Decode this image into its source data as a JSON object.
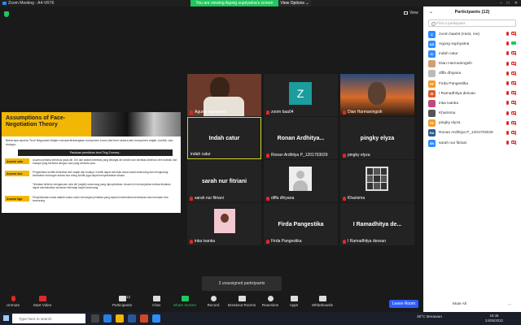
{
  "window": {
    "title": "Zoom Meeting - A4-VR76",
    "share_banner": "You are viewing Agung supriyatna's screen",
    "view_options": "View Options ⌄",
    "view_label": "View"
  },
  "slide": {
    "title": "Assumptions of Face-Negotiation Theory",
    "intro": "Beberapa asumsi Teori Negosiasi Wajah mempertimbangkan komponen kunci dari teori antara lain komponen wajah, konflik, dan budaya.",
    "bar": "Panduan pemikiran teori Ting-Toomey :",
    "rows": [
      {
        "label": "Asumsi satu",
        "text": "Asumsi pertama berfokus pada diri. Diri dan adalah identitas yang dihargai diri sendiri dan identitas dibentuk oleh individu dari budaya yang berbeda dengan cara yang berbeda pula."
      },
      {
        "label": "Asumsi dua",
        "text": "Pengelolaan konflik dimediasi oleh wajah dan budaya. Konflik dapat merusak muka sosial seseorang dan mengurangi kedekatan hubungan antara dua orang konflik juga dapat menyelesaikan situasi."
      },
      {
        "label": "",
        "text": "Tindakan tertentu mengancam citra diri (wajah) seseorang yang diproyeksikan. Asumsi ini menunjukkan bahwa tindakan dapat menimbulkan ancaman terhadap wajah seseorang."
      },
      {
        "label": "Asumsi tiga",
        "text": "Penyelamatan muka adalah usaha untuk mencegah peristiwa yang dapat menimbulkan kerentanan dan merusak citra seseorang."
      }
    ]
  },
  "tiles": [
    {
      "name": "Agung supriyatna",
      "big": ""
    },
    {
      "name": "zoom baa04",
      "big": "",
      "avatar": "Z"
    },
    {
      "name": "Dian Harmaningsih",
      "big": ""
    },
    {
      "name": "indah catur",
      "big": "Indah catur"
    },
    {
      "name": "Ronan Ardhitya P_1201703029",
      "big": "Ronan  Ardhitya..."
    },
    {
      "name": "pingky elyza",
      "big": "pingky elyza"
    },
    {
      "name": "sarah nur fitriani",
      "big": "sarah nur fitriani"
    },
    {
      "name": "diffa dhiyana",
      "big": ""
    },
    {
      "name": "Kharisma",
      "big": ""
    },
    {
      "name": "inka ivanka",
      "big": ""
    },
    {
      "name": "Firda Pangestika",
      "big": "Firda Pangestika"
    },
    {
      "name": "I Ramadhitya desvan",
      "big": "I Ramadhitya de..."
    }
  ],
  "unassigned": "3 unassigned participants",
  "toolbar": {
    "unmute": "Unmute",
    "start_video": "Start Video",
    "participants": "Participants",
    "participants_count": "12",
    "chat": "Chat",
    "share_screen": "Share Screen",
    "record": "Record",
    "breakout": "Breakout Rooms",
    "reactions": "Reactions",
    "apps": "Apps",
    "whiteboards": "Whiteboards",
    "leave": "Leave Room"
  },
  "panel": {
    "title": "Participants (12)",
    "search_placeholder": "Find a participant",
    "participants": [
      {
        "initials": "Z",
        "name": "zoom baa04 (Host, me)",
        "color": "#2d8cff",
        "video": "off"
      },
      {
        "initials": "AS",
        "name": "Agung supriyatna",
        "color": "#2d8cff",
        "video": "on"
      },
      {
        "initials": "IC",
        "name": "indah catur",
        "color": "#2d8cff",
        "video": "off"
      },
      {
        "initials": "",
        "name": "Dian Harmaningsih",
        "color": "#d0a070",
        "video": "off"
      },
      {
        "initials": "",
        "name": "diffa dhiyana",
        "color": "#bbbbbb",
        "video": "off"
      },
      {
        "initials": "FP",
        "name": "Firda Pangestika",
        "color": "#f59b26",
        "video": "off"
      },
      {
        "initials": "IR",
        "name": "I Ramadhitya desvan",
        "color": "#e05a2b",
        "video": "off"
      },
      {
        "initials": "",
        "name": "inka ivanka",
        "color": "#c24a7a",
        "video": "off"
      },
      {
        "initials": "",
        "name": "Kharisma",
        "color": "#555555",
        "video": "off"
      },
      {
        "initials": "PE",
        "name": "pingky elyza",
        "color": "#f59b26",
        "video": "off"
      },
      {
        "initials": "RA",
        "name": "Ronan Ardhitya P_1201703029",
        "color": "#2d5a8c",
        "video": "off"
      },
      {
        "initials": "SN",
        "name": "sarah nur fitriani",
        "color": "#2d8cff",
        "video": "off"
      }
    ],
    "mute_all": "Mute All",
    "more": "..."
  },
  "taskbar": {
    "search_placeholder": "Type here to search",
    "weather": "30°C  Berawan",
    "time": "18:48",
    "date": "24/05/2022"
  }
}
